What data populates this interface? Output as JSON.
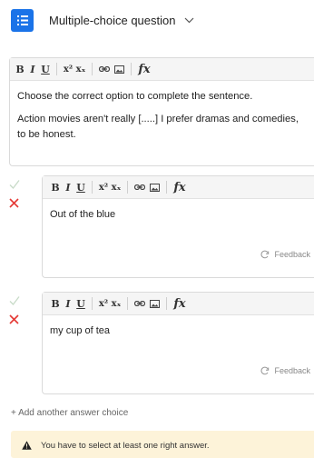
{
  "header": {
    "title": "Multiple-choice question"
  },
  "question_editor": {
    "toolbar": {
      "bold": "B",
      "italic": "I",
      "underline": "U",
      "superscript": "x²",
      "subscript": "xₓ",
      "formula": "fx"
    },
    "paragraphs": [
      "Choose the correct option to complete the sentence.",
      "Action movies aren't really [.....] I prefer dramas and comedies, to be honest."
    ]
  },
  "answers": [
    {
      "text": "Out of the blue",
      "feedback_label": "Feedback"
    },
    {
      "text": "my cup of tea",
      "feedback_label": "Feedback"
    }
  ],
  "add_answer_label": "+ Add another answer choice",
  "warning": {
    "text": "You have to select at least one right answer."
  },
  "colors": {
    "accent": "#1a73e8",
    "wrong": "#e53935",
    "correct_inactive": "#c8dbc8",
    "warning_bg": "#fdf3d9"
  }
}
